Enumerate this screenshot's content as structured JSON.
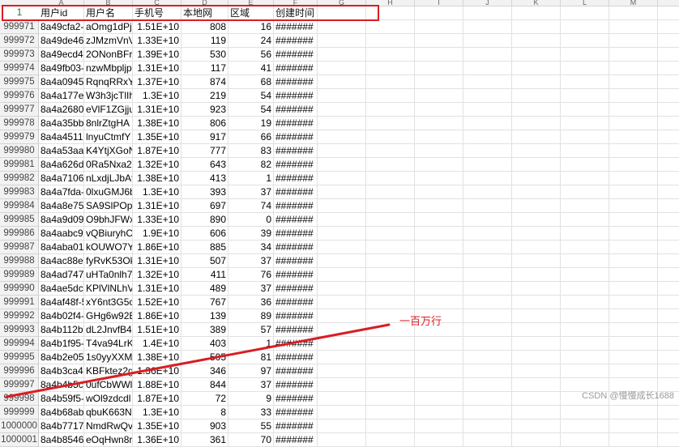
{
  "column_letters": [
    "A",
    "B",
    "C",
    "D",
    "E",
    "F",
    "G",
    "H",
    "I",
    "J",
    "K",
    "L",
    "M",
    "N"
  ],
  "header_row": {
    "row_number": "1",
    "cells": [
      "用户id",
      "用户名",
      "手机号",
      "本地网",
      "区域",
      "创建时间"
    ]
  },
  "rows": [
    {
      "n": "999971",
      "id": "8a49cfa2-8",
      "name": "aOmg1dPj",
      "phone": "1.51E+10",
      "net": "808",
      "area": "16",
      "time": "#######"
    },
    {
      "n": "999972",
      "id": "8a49de46-2",
      "name": "zJMzmVnV",
      "phone": "1.33E+10",
      "net": "119",
      "area": "24",
      "time": "#######"
    },
    {
      "n": "999973",
      "id": "8a49ecd4-7",
      "name": "2ONonBFr",
      "phone": "1.39E+10",
      "net": "530",
      "area": "56",
      "time": "#######"
    },
    {
      "n": "999974",
      "id": "8a49fb03-",
      "name": "nzwMbpljp",
      "phone": "1.31E+10",
      "net": "117",
      "area": "41",
      "time": "#######"
    },
    {
      "n": "999975",
      "id": "8a4a0945-",
      "name": "RqnqRRxY",
      "phone": "1.37E+10",
      "net": "874",
      "area": "68",
      "time": "#######"
    },
    {
      "n": "999976",
      "id": "8a4a177e-",
      "name": "W3h3jcTlIh",
      "phone": "1.3E+10",
      "net": "219",
      "area": "54",
      "time": "#######"
    },
    {
      "n": "999977",
      "id": "8a4a2680-",
      "name": "eVlF1ZGjju",
      "phone": "1.31E+10",
      "net": "923",
      "area": "54",
      "time": "#######"
    },
    {
      "n": "999978",
      "id": "8a4a35bb-",
      "name": "8nlrZtgHA",
      "phone": "1.38E+10",
      "net": "806",
      "area": "19",
      "time": "#######"
    },
    {
      "n": "999979",
      "id": "8a4a4511-",
      "name": "lnyuCtmfY",
      "phone": "1.35E+10",
      "net": "917",
      "area": "66",
      "time": "#######"
    },
    {
      "n": "999980",
      "id": "8a4a53aa-",
      "name": "K4YtjXGoN",
      "phone": "1.87E+10",
      "net": "777",
      "area": "83",
      "time": "#######"
    },
    {
      "n": "999981",
      "id": "8a4a626d-",
      "name": "0Ra5Nxa2",
      "phone": "1.32E+10",
      "net": "643",
      "area": "82",
      "time": "#######"
    },
    {
      "n": "999982",
      "id": "8a4a7106-",
      "name": "nLxdjLJbAt",
      "phone": "1.38E+10",
      "net": "413",
      "area": "1",
      "time": "#######"
    },
    {
      "n": "999983",
      "id": "8a4a7fda-",
      "name": "0lxuGMJ6b",
      "phone": "1.3E+10",
      "net": "393",
      "area": "37",
      "time": "#######"
    },
    {
      "n": "999984",
      "id": "8a4a8e75-",
      "name": "SA9SlPOpu",
      "phone": "1.31E+10",
      "net": "697",
      "area": "74",
      "time": "#######"
    },
    {
      "n": "999985",
      "id": "8a4a9d09-",
      "name": "O9bhJFWx",
      "phone": "1.33E+10",
      "net": "890",
      "area": "0",
      "time": "#######"
    },
    {
      "n": "999986",
      "id": "8a4aabc9-",
      "name": "vQBiuryhC",
      "phone": "1.9E+10",
      "net": "606",
      "area": "39",
      "time": "#######"
    },
    {
      "n": "999987",
      "id": "8a4aba01-",
      "name": "kOUWO7Y",
      "phone": "1.86E+10",
      "net": "885",
      "area": "34",
      "time": "#######"
    },
    {
      "n": "999988",
      "id": "8a4ac88e-",
      "name": "fyRvK53Ok",
      "phone": "1.31E+10",
      "net": "507",
      "area": "37",
      "time": "#######"
    },
    {
      "n": "999989",
      "id": "8a4ad747-",
      "name": "uHTa0nlh7",
      "phone": "1.32E+10",
      "net": "411",
      "area": "76",
      "time": "#######"
    },
    {
      "n": "999990",
      "id": "8a4ae5dc-",
      "name": "KPlVlNLhV",
      "phone": "1.31E+10",
      "net": "489",
      "area": "37",
      "time": "#######"
    },
    {
      "n": "999991",
      "id": "8a4af48f-5",
      "name": "xY6nt3G5c",
      "phone": "1.52E+10",
      "net": "767",
      "area": "36",
      "time": "#######"
    },
    {
      "n": "999992",
      "id": "8a4b02f4-",
      "name": "GHg6w92E",
      "phone": "1.86E+10",
      "net": "139",
      "area": "89",
      "time": "#######"
    },
    {
      "n": "999993",
      "id": "8a4b112b-",
      "name": "dL2JnvfB4r",
      "phone": "1.51E+10",
      "net": "389",
      "area": "57",
      "time": "#######"
    },
    {
      "n": "999994",
      "id": "8a4b1f95-",
      "name": "T4va94LrKl",
      "phone": "1.4E+10",
      "net": "403",
      "area": "1",
      "time": "#######"
    },
    {
      "n": "999995",
      "id": "8a4b2e05-",
      "name": "1s0yyXXM5",
      "phone": "1.38E+10",
      "net": "505",
      "area": "81",
      "time": "#######"
    },
    {
      "n": "999996",
      "id": "8a4b3ca4-",
      "name": "KBFktez2g",
      "phone": "1.36E+10",
      "net": "346",
      "area": "97",
      "time": "#######"
    },
    {
      "n": "999997",
      "id": "8a4b4b5c-",
      "name": "0ufCbWWl",
      "phone": "1.88E+10",
      "net": "844",
      "area": "37",
      "time": "#######"
    },
    {
      "n": "999998",
      "id": "8a4b59f5-",
      "name": "wOl9zdcdl",
      "phone": "1.87E+10",
      "net": "72",
      "area": "9",
      "time": "#######"
    },
    {
      "n": "999999",
      "id": "8a4b68ab-",
      "name": "qbuK663N",
      "phone": "1.3E+10",
      "net": "8",
      "area": "33",
      "time": "#######"
    },
    {
      "n": "1000000",
      "id": "8a4b7717-",
      "name": "NmdRwQv",
      "phone": "1.35E+10",
      "net": "903",
      "area": "55",
      "time": "#######"
    },
    {
      "n": "1000001",
      "id": "8a4b8546-",
      "name": "eOqHwn8r",
      "phone": "1.36E+10",
      "net": "361",
      "area": "70",
      "time": "#######"
    }
  ],
  "annotation": {
    "label": "一百万行",
    "color": "#d81e24"
  },
  "watermark": "CSDN @慢慢成长1688",
  "colors": {
    "header_bg": "#f2f2f2",
    "gridline": "#e1e1e1",
    "annotation_red": "#d81e24",
    "row1_number_green": "#1f6f3b"
  }
}
